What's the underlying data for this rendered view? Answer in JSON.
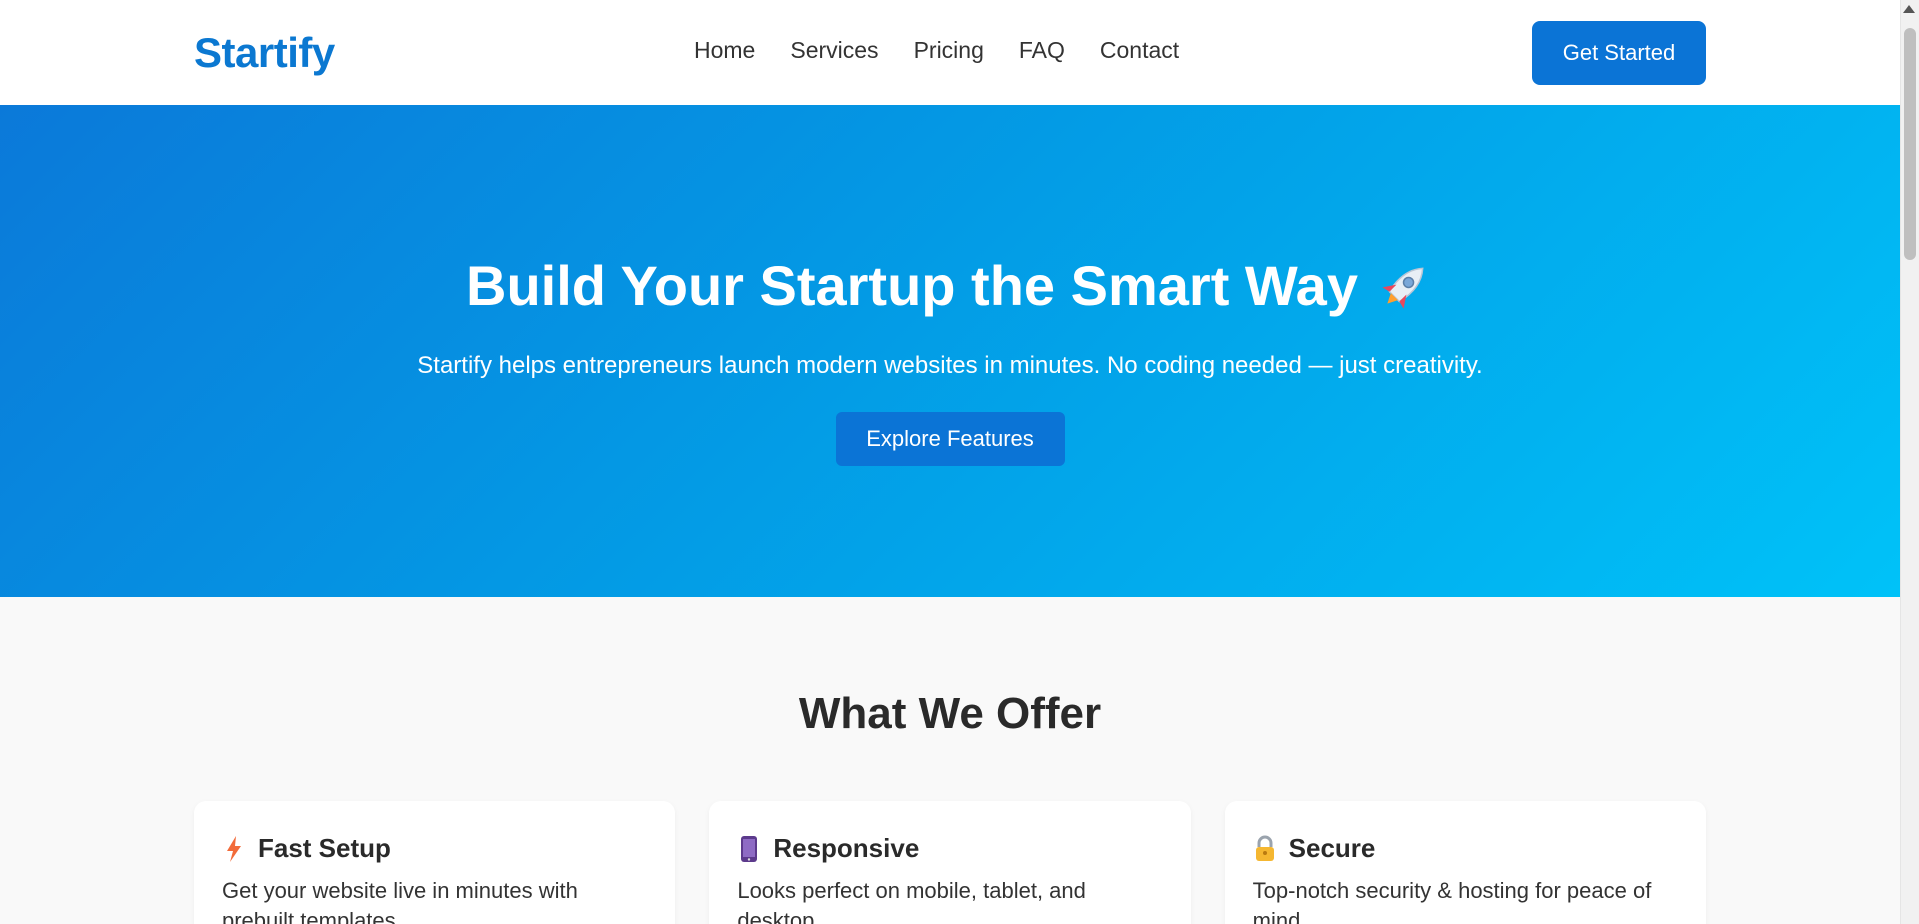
{
  "brand": {
    "name": "Startify"
  },
  "nav": {
    "items": [
      "Home",
      "Services",
      "Pricing",
      "FAQ",
      "Contact"
    ]
  },
  "header": {
    "cta_label": "Get Started"
  },
  "hero": {
    "title": "Build Your Startup the Smart Way",
    "emoji": "rocket-icon",
    "subtitle": "Startify helps entrepreneurs launch modern websites in minutes. No coding needed — just creativity.",
    "button_label": "Explore Features"
  },
  "offers": {
    "title": "What We Offer",
    "cards": [
      {
        "icon": "lightning-icon",
        "title": "Fast Setup",
        "text": "Get your website live in minutes with prebuilt templates."
      },
      {
        "icon": "mobile-phone-icon",
        "title": "Responsive",
        "text": "Looks perfect on mobile, tablet, and desktop."
      },
      {
        "icon": "lock-icon",
        "title": "Secure",
        "text": "Top-notch security & hosting for peace of mind."
      }
    ]
  },
  "colors": {
    "brand": "#0b78d1",
    "button": "#0b74d6",
    "hero_start": "#0b79d9",
    "hero_end": "#00c2f8"
  }
}
